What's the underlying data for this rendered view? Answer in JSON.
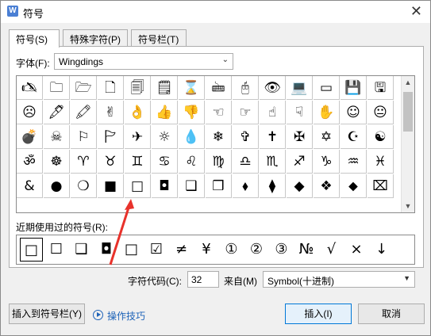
{
  "window": {
    "app_icon_letter": "W",
    "title": "符号",
    "close_glyph": "✕"
  },
  "tabs": [
    {
      "label": "符号(S)",
      "active": true
    },
    {
      "label": "特殊字符(P)",
      "active": false
    },
    {
      "label": "符号栏(T)",
      "active": false
    }
  ],
  "font": {
    "label": "字体(F):",
    "value": "Wingdings",
    "arrow": "⌄"
  },
  "symbol_grid": {
    "rows": [
      [
        "🖎",
        "🗀",
        "🗁",
        "🗋",
        "🗐",
        "🗒",
        "⌛",
        "🖮",
        "🖰",
        "👁",
        "💻",
        "▭",
        "💾",
        "🖫"
      ],
      [
        "☹",
        "🖋",
        "🖍",
        "✌",
        "👌",
        "👍",
        "👎",
        "☜",
        "☞",
        "☝",
        "☟",
        "✋",
        "☺",
        "😐"
      ],
      [
        "💣",
        "☠",
        "⚐",
        "🏱",
        "✈",
        "☼",
        "💧",
        "❄",
        "✞",
        "✝",
        "✠",
        "✡",
        "☪",
        "☯"
      ],
      [
        "ॐ",
        "☸",
        "♈",
        "♉",
        "♊",
        "♋",
        "♌",
        "♍",
        "♎",
        "♏",
        "♐",
        "♑",
        "♒",
        "♓"
      ],
      [
        "&",
        "●",
        "❍",
        "■",
        "□",
        "◘",
        "❑",
        "❒",
        "⬧",
        "⧫",
        "◆",
        "❖",
        "⬥",
        "⌧"
      ]
    ],
    "last_cell_extra": [
      "☹",
      "⍓"
    ],
    "scroll_up": "▲",
    "scroll_down": "▼"
  },
  "recent": {
    "label": "近期使用过的符号(R):",
    "symbols": [
      "□",
      "☐",
      "❑",
      "◘",
      "□",
      "☑",
      "≠",
      "¥",
      "①",
      "②",
      "③",
      "№",
      "√",
      "×",
      "↓"
    ]
  },
  "code": {
    "label": "字符代码(C):",
    "value": "32"
  },
  "from": {
    "label": "来自(M)",
    "value": "Symbol(十进制)",
    "arrow": "▼"
  },
  "buttons": {
    "insert_to_bar": "插入到符号栏(Y)",
    "tips": "操作技巧",
    "insert": "插入(I)",
    "cancel": "取消"
  },
  "colors": {
    "accent": "#0078d7",
    "link": "#1e63b8",
    "arrow_annotation": "#e8322b"
  }
}
